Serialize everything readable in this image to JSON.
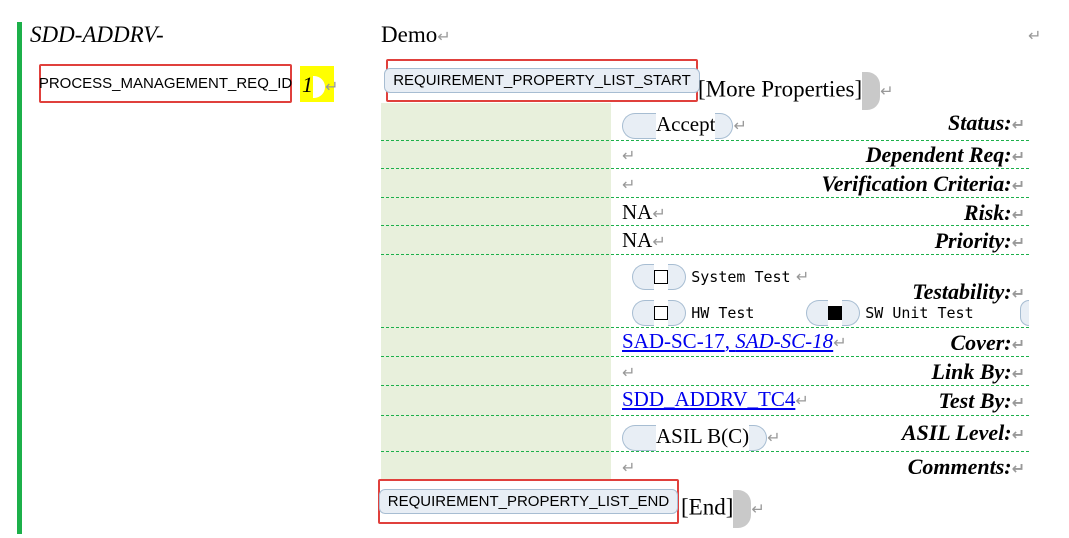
{
  "requirement": {
    "id_prefix": "SDD-ADDRV-",
    "title": "Demo",
    "pm_tag": "PROCESS_MANAGEMENT_REQ_ID",
    "pm_value": "1",
    "start_tag": "REQUIREMENT_PROPERTY_LIST_START",
    "more_label": "[More Properties]",
    "end_tag": "REQUIREMENT_PROPERTY_LIST_END",
    "end_label": "[End]",
    "para_mark": "↵"
  },
  "properties": {
    "status_label": "Status:",
    "status_value": "Accept",
    "dependent_label": "Dependent Req:",
    "verification_label": "Verification Criteria:",
    "risk_label": "Risk:",
    "risk_value": "NA",
    "priority_label": "Priority:",
    "priority_value": "NA",
    "testability_label": "Testability:",
    "testability_options": [
      {
        "label": "System Test",
        "checked": false
      },
      {
        "label": "HW Test",
        "checked": false
      },
      {
        "label": "SW Unit Test",
        "checked": true
      }
    ],
    "cover_label": "Cover:",
    "cover_links": [
      "SAD-SC-17",
      "SAD-SC-18"
    ],
    "cover_sep": ", ",
    "linkby_label": "Link By:",
    "testby_label": "Test By:",
    "testby_link": "SDD_ADDRV_TC4",
    "asil_label": "ASIL Level:",
    "asil_value": "ASIL B(C)",
    "comments_label": "Comments:"
  },
  "colors": {
    "accent_green": "#1cb04a",
    "tag_border_red": "#e0403c",
    "label_bg": "#e8f0dc",
    "highlight_yellow": "#ffff00",
    "link_blue": "#0000ee"
  }
}
